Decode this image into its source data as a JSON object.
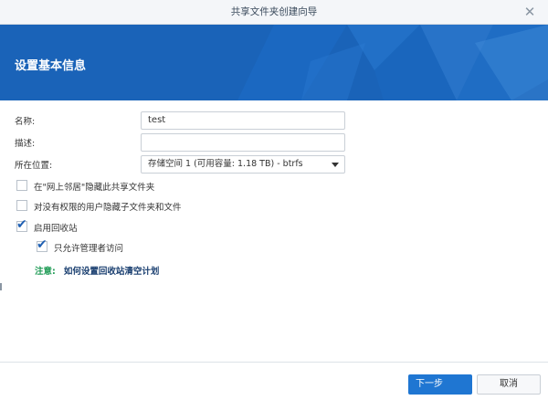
{
  "window": {
    "title": "共享文件夹创建向导",
    "close_icon": "close-icon",
    "close_glyph": "✕"
  },
  "banner": {
    "heading": "设置基本信息",
    "color": "#1a63b8"
  },
  "form": {
    "name_label": "名称:",
    "name_value": "test",
    "desc_label": "描述:",
    "desc_value": "",
    "location_label": "所在位置:",
    "location_value": "存储空间 1 (可用容量:  1.18 TB) - btrfs",
    "options": [
      {
        "label": "在\"网上邻居\"隐藏此共享文件夹",
        "checked": false
      },
      {
        "label": "对没有权限的用户隐藏子文件夹和文件",
        "checked": false
      },
      {
        "label": "启用回收站",
        "checked": true
      },
      {
        "label": "只允许管理者访问",
        "checked": true
      }
    ],
    "note_label": "注意:",
    "note_link": "如何设置回收站清空计划"
  },
  "footer": {
    "next_label": "下一步",
    "cancel_label": "取消"
  },
  "colors": {
    "accent": "#1f76d2",
    "check": "#1e5fb3",
    "note": "#1f9b55"
  }
}
